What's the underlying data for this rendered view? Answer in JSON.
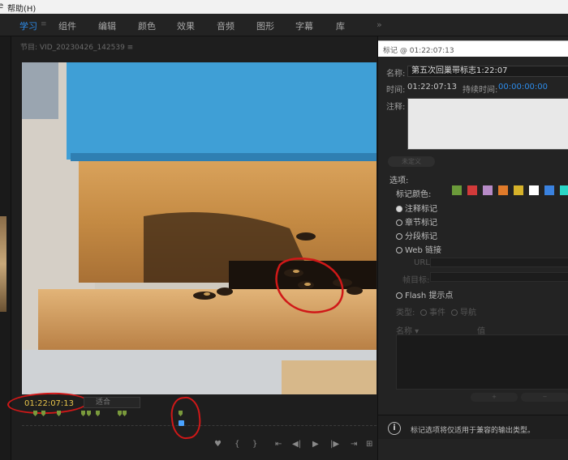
{
  "menubar": {
    "item_partial": "e",
    "help": "帮助(H)"
  },
  "workspace": {
    "tabs": [
      {
        "label": "学习",
        "active": true
      },
      {
        "label": "组件"
      },
      {
        "label": "编辑"
      },
      {
        "label": "颜色"
      },
      {
        "label": "效果"
      },
      {
        "label": "音频"
      },
      {
        "label": "图形"
      },
      {
        "label": "字幕"
      },
      {
        "label": "库"
      }
    ],
    "menu_glyph": "≡",
    "overflow": "»"
  },
  "monitor": {
    "title": "节目: VID_20230426_142539 ≡",
    "timecode": "01:22:07:13",
    "fit_label": "适合",
    "transport": [
      "♥",
      "{",
      "}",
      "⇤",
      "◀|",
      "▶",
      "|▶",
      "⇥",
      "⊞",
      "⊟",
      "⊡"
    ]
  },
  "marker_panel": {
    "header": "标记 @ 01:22:07:13",
    "name_label": "名称:",
    "name_value": "第五次回巢带标志1:22:07",
    "time_label": "时间:",
    "time_value": "01:22:07:13",
    "duration_label": "持续时间:",
    "duration_value": "00:00:00:00",
    "comment_label": "注释:",
    "undefine_label": "未定义",
    "options_label": "选项:",
    "color_label": "标记颜色:",
    "colors": [
      "#6b9a3a",
      "#d23a3a",
      "#b68ac6",
      "#e07a2a",
      "#d6b22a",
      "#ffffff",
      "#3a82e0",
      "#2ad6c6"
    ],
    "radios": [
      {
        "label": "注释标记",
        "on": true
      },
      {
        "label": "章节标记",
        "on": false
      },
      {
        "label": "分段标记",
        "on": false
      },
      {
        "label": "Web 链接",
        "on": false
      },
      {
        "label": "Flash 提示点",
        "on": false
      }
    ],
    "url_label": "URL:",
    "frame_target_label": "帧目标:",
    "type_label": "类型:",
    "event_label": "事件",
    "nav_label": "导航",
    "col_name": "名称 ▾",
    "col_value": "值",
    "add_btn": "+",
    "remove_btn": "−",
    "info_text": "标记选项将仅适用于兼容的输出类型。"
  }
}
